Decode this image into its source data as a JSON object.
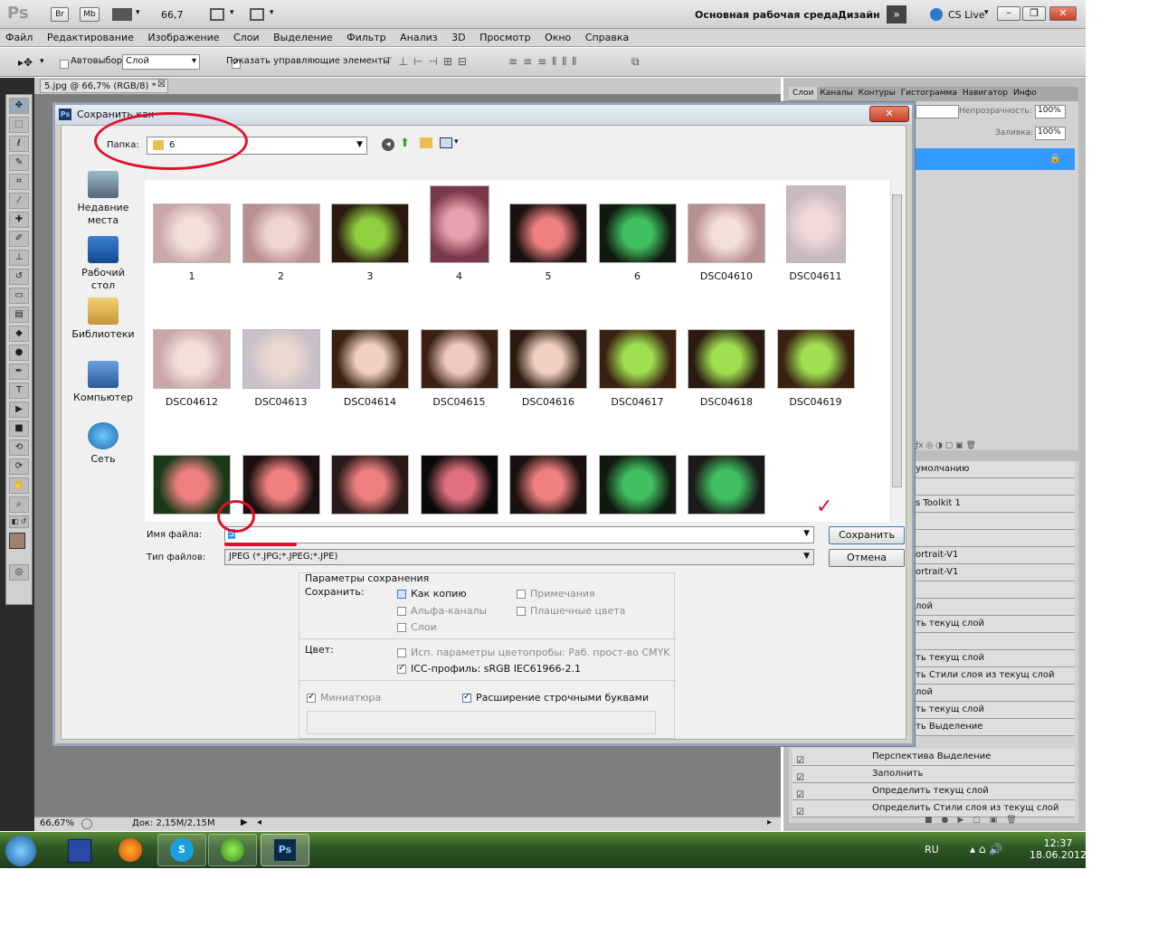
{
  "app": {
    "logo": "Ps",
    "zoom": "66,7",
    "workspace": "Основная рабочая среда",
    "design": "Дизайн",
    "cslive": "CS Live",
    "br": "Br",
    "mb": "Mb"
  },
  "menu": [
    "Файл",
    "Редактирование",
    "Изображение",
    "Слои",
    "Выделение",
    "Фильтр",
    "Анализ",
    "3D",
    "Просмотр",
    "Окно",
    "Справка"
  ],
  "options": {
    "autoselect": "Автовыбор:",
    "autoselect_value": "Слой",
    "show_controls": "Показать управляющие элементы"
  },
  "document": {
    "tab": "5.jpg @ 66,7% (RGB/8) *"
  },
  "status": {
    "zoom": "66,67%",
    "doc": "Док: 2,15M/2,15M"
  },
  "panels": {
    "tabs": [
      "Слои",
      "Каналы",
      "Контуры",
      "Гистограмма",
      "Навигатор",
      "Инфо"
    ],
    "opacity_label": "Непрозрачность:",
    "opacity_value": "100%",
    "fill_label": "Заливка:",
    "fill_value": "100%"
  },
  "actions": [
    "умолчанию",
    "",
    "s Toolkit 1",
    "",
    "",
    "ortrait-V1",
    "ortrait-V1",
    "",
    "лой",
    "ть текущ слой",
    "",
    "ть текущ слой",
    "ть Стили слоя из текущ слой",
    "лой",
    "ть текущ слой",
    "ть Выделение",
    "Перспектива Выделение",
    "Заполнить",
    "Определить текущ слой",
    "Определить Стили слоя из текущ слой"
  ],
  "dialog": {
    "title": "Сохранить как",
    "folder_label": "Папка:",
    "folder_value": "6",
    "places": [
      {
        "label": "Недавние места",
        "icon": "recent-places-icon"
      },
      {
        "label": "Рабочий стол",
        "icon": "desktop-icon"
      },
      {
        "label": "Библиотеки",
        "icon": "libraries-icon"
      },
      {
        "label": "Компьютер",
        "icon": "computer-icon"
      },
      {
        "label": "Сеть",
        "icon": "network-icon"
      }
    ],
    "files": [
      "1",
      "2",
      "3",
      "4",
      "5",
      "6",
      "DSC04610",
      "DSC04611",
      "DSC04612",
      "DSC04613",
      "DSC04614",
      "DSC04615",
      "DSC04616",
      "DSC04617",
      "DSC04618",
      "DSC04619",
      "",
      "",
      "",
      "",
      "",
      "",
      ""
    ],
    "filename_label": "Имя файла:",
    "filename_value": "5",
    "filetype_label": "Тип файлов:",
    "filetype_value": "JPEG (*.JPG;*.JPEG;*.JPE)",
    "save_button": "Сохранить",
    "cancel_button": "Отмена",
    "options_title": "Параметры сохранения",
    "save_label": "Сохранить:",
    "as_copy": "Как копию",
    "notes": "Примечания",
    "alpha": "Альфа-каналы",
    "spot": "Плашечные цвета",
    "layers": "Слои",
    "color_label": "Цвет:",
    "proof": "Исп. параметры цветопробы: Раб. прост-во CMYK",
    "icc": "ICC-профиль:  sRGB IEC61966-2.1",
    "thumbnail": "Миниатюра",
    "lowercase": "Расширение строчными буквами"
  },
  "taskbar": {
    "lang": "RU",
    "time": "12:37",
    "date": "18.06.2012"
  },
  "colors": {
    "accent_red": "#e0102a",
    "selection_blue": "#3399ff"
  }
}
